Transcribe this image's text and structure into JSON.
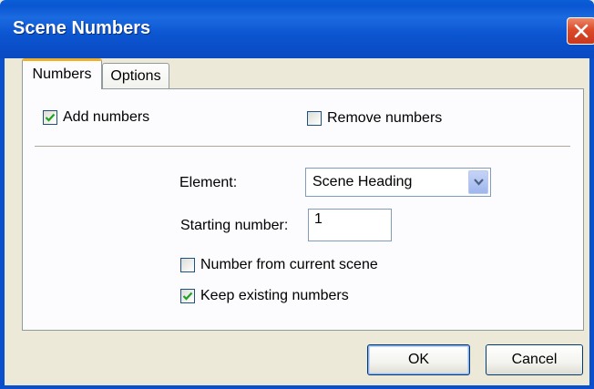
{
  "window": {
    "title": "Scene Numbers",
    "close_icon": "close-icon"
  },
  "tabs": [
    {
      "label": "Numbers",
      "active": true
    },
    {
      "label": "Options",
      "active": false
    }
  ],
  "numbers_tab": {
    "add_numbers": {
      "label": "Add numbers",
      "checked": true
    },
    "remove_numbers": {
      "label": "Remove numbers",
      "checked": false
    },
    "element": {
      "label": "Element:",
      "value": "Scene Heading"
    },
    "starting_number": {
      "label": "Starting number:",
      "value": "1"
    },
    "number_from_current": {
      "label": "Number from current scene",
      "checked": false
    },
    "keep_existing": {
      "label": "Keep existing numbers",
      "checked": true
    }
  },
  "buttons": {
    "ok": "OK",
    "cancel": "Cancel"
  },
  "colors": {
    "titlebar": "#0a56d3",
    "close": "#dd4a2a",
    "dialog_bg": "#ece9d8",
    "panel_bg": "#fcfcfe",
    "active_tab_accent": "#f0b12a",
    "checkmark": "#21a121"
  }
}
